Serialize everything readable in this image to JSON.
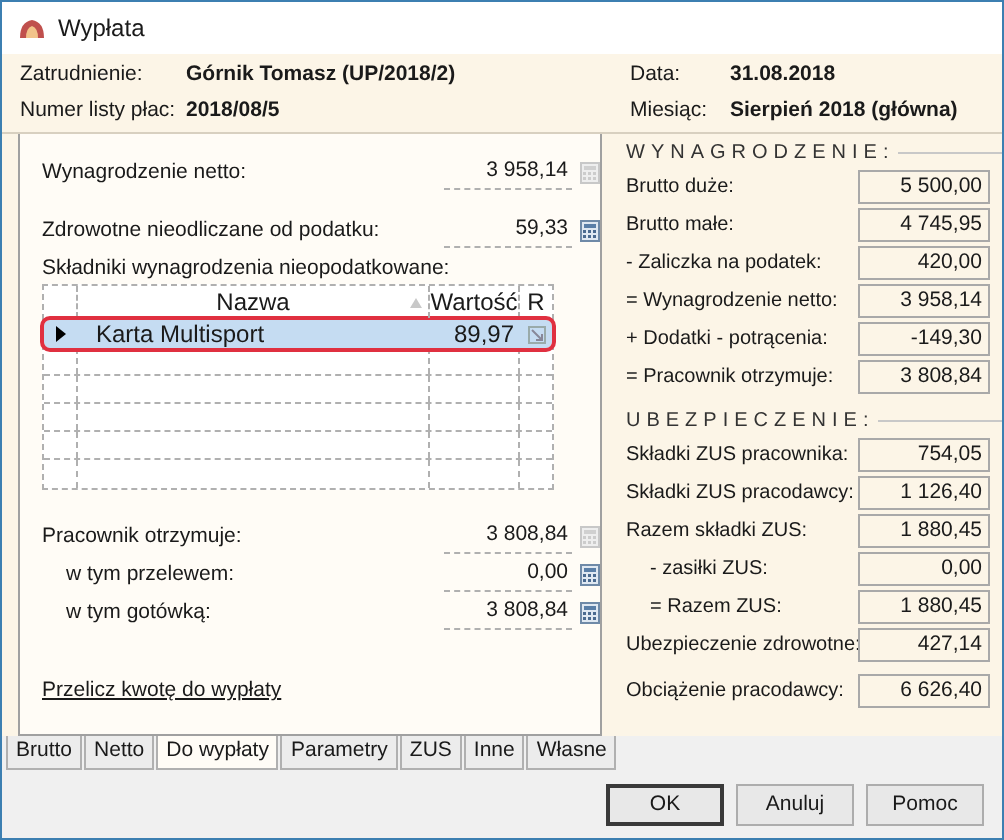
{
  "window": {
    "title": "Wypłata"
  },
  "header": {
    "left": [
      {
        "label": "Zatrudnienie:",
        "value": "Górnik Tomasz (UP/2018/2)"
      },
      {
        "label": "Numer listy płac:",
        "value": "2018/08/5"
      }
    ],
    "right": [
      {
        "label": "Data:",
        "value": "31.08.2018"
      },
      {
        "label": "Miesiąc:",
        "value": "Sierpień 2018 (główna)"
      }
    ]
  },
  "left_fields_top": [
    {
      "label": "Wynagrodzenie netto:",
      "value": "3 958,14",
      "calculator_enabled": false
    },
    {
      "label": "Zdrowotne nieodliczane od podatku:",
      "value": "59,33",
      "calculator_enabled": true
    }
  ],
  "table": {
    "label": "Składniki wynagrodzenia nieopodatkowane:",
    "columns": [
      "Nazwa",
      "Wartość",
      "R"
    ],
    "rows": [
      {
        "name": "Karta Multisport",
        "value": "89,97",
        "selected": true
      }
    ]
  },
  "left_fields_bottom": [
    {
      "label": "Pracownik otrzymuje:",
      "value": "3 808,84",
      "calculator_enabled": false,
      "kind": "main"
    },
    {
      "label": "w tym przelewem:",
      "value": "0,00",
      "calculator_enabled": true,
      "kind": "sub"
    },
    {
      "label": "w tym gotówką:",
      "value": "3 808,84",
      "calculator_enabled": true,
      "kind": "sub"
    }
  ],
  "link": "Przelicz kwotę do wypłaty",
  "sections": [
    {
      "title": "WYNAGRODZENIE:",
      "rows": [
        {
          "label": "Brutto duże:",
          "value": "5 500,00",
          "kind": "main"
        },
        {
          "label": "Brutto małe:",
          "value": "4 745,95",
          "kind": "main"
        },
        {
          "label": "- Zaliczka na podatek:",
          "value": "420,00",
          "kind": "main"
        },
        {
          "label": "= Wynagrodzenie netto:",
          "value": "3 958,14",
          "kind": "main"
        },
        {
          "label": "+ Dodatki - potrącenia:",
          "value": "-149,30",
          "kind": "main"
        },
        {
          "label": "= Pracownik otrzymuje:",
          "value": "3 808,84",
          "kind": "main"
        }
      ]
    },
    {
      "title": "UBEZPIECZENIE:",
      "rows": [
        {
          "label": "Składki ZUS pracownika:",
          "value": "754,05",
          "kind": "main"
        },
        {
          "label": "Składki ZUS pracodawcy:",
          "value": "1 126,40",
          "kind": "main"
        },
        {
          "label": "Razem składki ZUS:",
          "value": "1 880,45",
          "kind": "main"
        },
        {
          "label": "- zasiłki ZUS:",
          "value": "0,00",
          "kind": "sub"
        },
        {
          "label": "= Razem ZUS:",
          "value": "1 880,45",
          "kind": "sub"
        },
        {
          "label": "Ubezpieczenie zdrowotne:",
          "value": "427,14",
          "kind": "main"
        }
      ]
    }
  ],
  "employer_cost": {
    "label": "Obciążenie pracodawcy:",
    "value": "6 626,40"
  },
  "tabs": [
    {
      "label": "Brutto",
      "selected": false
    },
    {
      "label": "Netto",
      "selected": false
    },
    {
      "label": "Do wypłaty",
      "selected": true
    },
    {
      "label": "Parametry",
      "selected": false
    },
    {
      "label": "ZUS",
      "selected": false
    },
    {
      "label": "Inne",
      "selected": false
    },
    {
      "label": "Własne",
      "selected": false
    }
  ],
  "buttons": [
    {
      "label": "OK",
      "kind": "default"
    },
    {
      "label": "Anuluj",
      "kind": "normal"
    },
    {
      "label": "Pomoc",
      "kind": "normal"
    }
  ]
}
